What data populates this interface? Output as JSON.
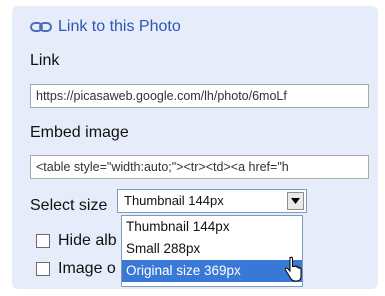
{
  "link_section": {
    "icon": "link-icon",
    "text": "Link to this Photo"
  },
  "link": {
    "label": "Link",
    "value": "https://picasaweb.google.com/lh/photo/6moLf"
  },
  "embed": {
    "label": "Embed image",
    "value": "<table style=\"width:auto;\"><tr><td><a href=\"h"
  },
  "select_size": {
    "label": "Select size",
    "selected": "Thumbnail 144px",
    "options": [
      "Thumbnail 144px",
      "Small 288px",
      "Original size 369px"
    ],
    "highlighted_option": "Original size 369px"
  },
  "checkboxes": [
    {
      "label": "Hide alb",
      "checked": false
    },
    {
      "label": "Image o",
      "checked": false
    }
  ],
  "colors": {
    "panel_background": "#e6ecf9",
    "link_blue": "#2b57b6",
    "highlight": "#3a78d8"
  }
}
